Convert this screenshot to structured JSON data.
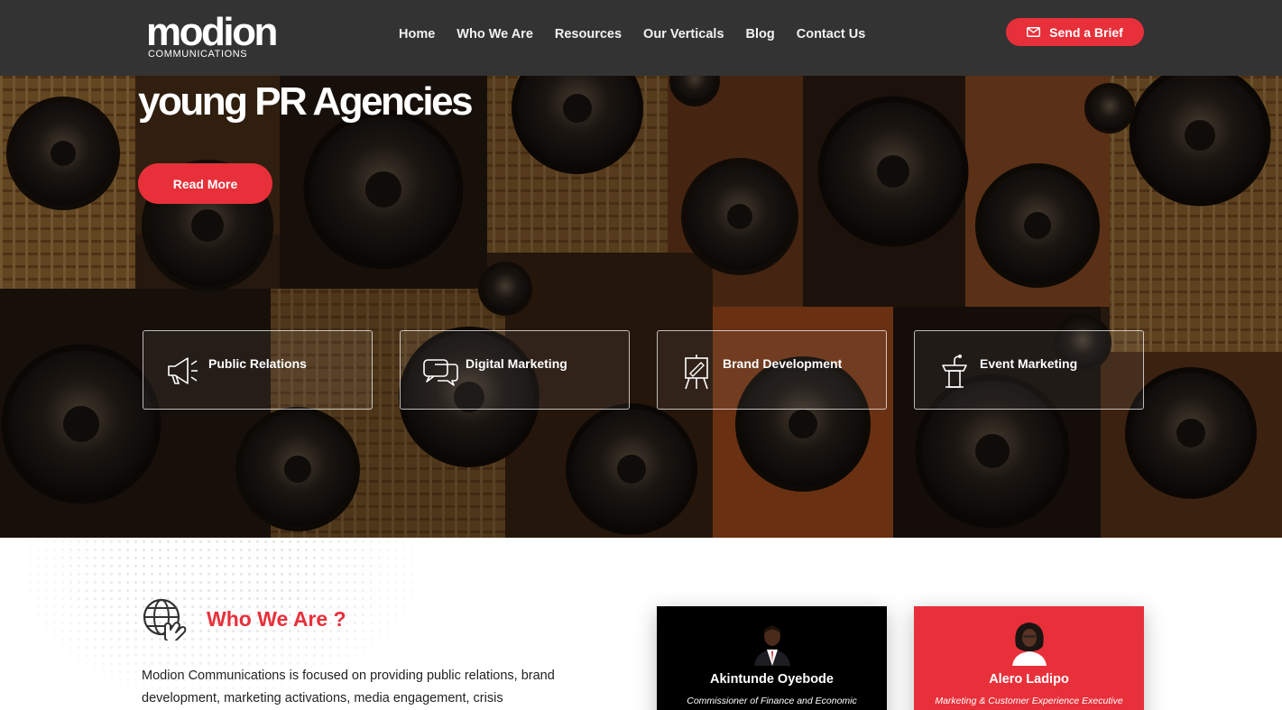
{
  "nav": {
    "logo_text": "modion",
    "logo_sub": "COMMUNICATIONS",
    "links": [
      "Home",
      "Who We Are",
      "Resources",
      "Our Verticals",
      "Blog",
      "Contact Us"
    ],
    "cta_label": "Send a Brief",
    "cta_icon": "envelope-icon"
  },
  "hero": {
    "title": "young PR Agencies",
    "read_more": "Read More",
    "services": [
      {
        "label": "Public Relations",
        "icon": "megaphone-icon"
      },
      {
        "label": "Digital Marketing",
        "icon": "chat-bubbles-icon"
      },
      {
        "label": "Brand Development",
        "icon": "easel-icon"
      },
      {
        "label": "Event Marketing",
        "icon": "podium-icon"
      }
    ]
  },
  "about": {
    "title": "Who We Are ?",
    "icon": "globe-hand-icon",
    "text": "Modion Communications is focused on providing public relations, brand development, marketing activations, media engagement, crisis"
  },
  "team": [
    {
      "name": "Akintunde Oyebode",
      "role": "Commissioner of Finance and Economic"
    },
    {
      "name": "Alero Ladipo",
      "role": "Marketing & Customer Experience Executive"
    }
  ],
  "colors": {
    "accent": "#e8303a",
    "nav_bg": "#333333"
  }
}
